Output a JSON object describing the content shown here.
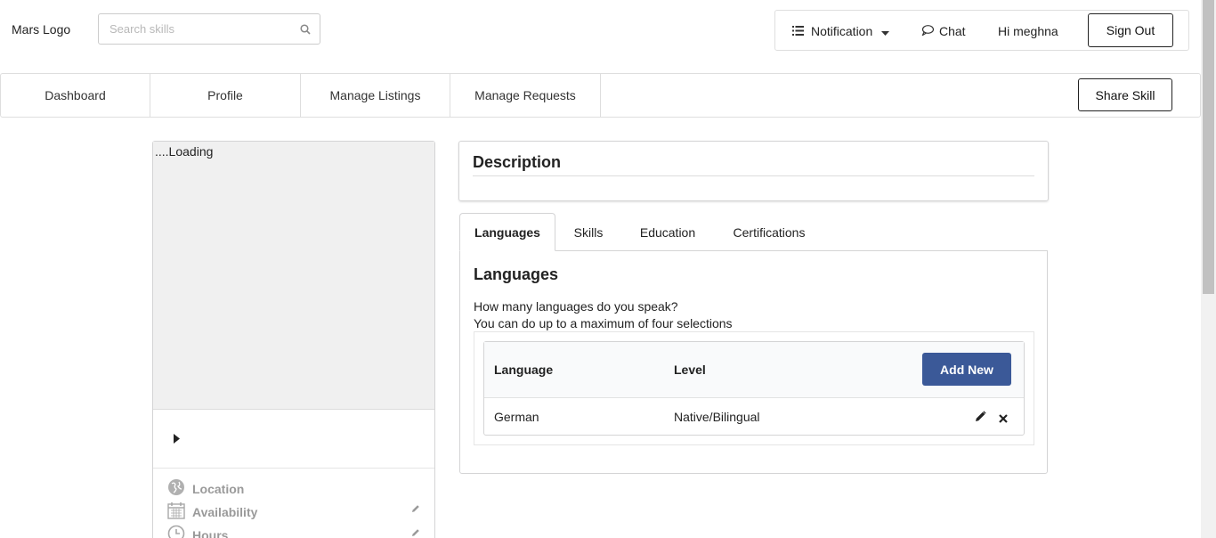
{
  "header": {
    "logo": "Mars Logo",
    "search_placeholder": "Search skills",
    "notification_label": "Notification",
    "chat_label": "Chat",
    "greeting": "Hi meghna",
    "signout_label": "Sign Out"
  },
  "nav": {
    "items": [
      "Dashboard",
      "Profile",
      "Manage Listings",
      "Manage Requests"
    ],
    "share_label": "Share Skill"
  },
  "profile": {
    "image_alt": "....Loading",
    "location_label": "Location",
    "availability_label": "Availability",
    "hours_label": "Hours"
  },
  "description": {
    "title": "Description"
  },
  "tabs": [
    "Languages",
    "Skills",
    "Education",
    "Certifications"
  ],
  "languages": {
    "title": "Languages",
    "question": "How many languages do you speak?",
    "hint": "You can do up to a maximum of four selections",
    "col_language": "Language",
    "col_level": "Level",
    "add_label": "Add New",
    "rows": [
      {
        "language": "German",
        "level": "Native/Bilingual"
      }
    ]
  },
  "colors": {
    "primary_button": "#3b5998",
    "meta_gray": "#9a9a9a"
  },
  "icons": [
    "search-icon",
    "list-icon",
    "caret-down-icon",
    "chat-bubble-icon",
    "play-icon",
    "globe-icon",
    "calendar-icon",
    "clock-icon",
    "pencil-icon",
    "close-icon"
  ]
}
